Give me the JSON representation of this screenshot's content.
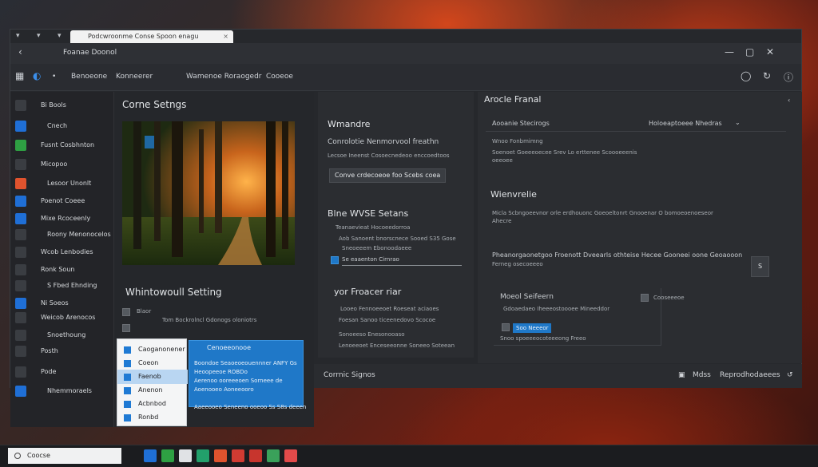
{
  "browser": {
    "tab_title": "Podcwroonme Conse Spoon enagu",
    "tab_close": "×",
    "back_glyph": "‹",
    "window_title": "Foanae Doonol"
  },
  "toolbar": {
    "items": [
      "Benoeone",
      "Konneerer",
      "Wamenoe Roraogedr",
      "Cooeoe"
    ]
  },
  "sidebar": {
    "items": [
      {
        "label": "Bi Bools",
        "color": "#3a3d42"
      },
      {
        "label": "Cnech",
        "color": "#1f6fd6"
      },
      {
        "label": "Fusnt Cosbhnton",
        "color": "#2ea043"
      },
      {
        "label": "Micopoo",
        "color": "#3a3d42"
      },
      {
        "label": "Lesoor Unonlt",
        "color": "#e0532e"
      },
      {
        "label": "Poenot Coeee",
        "color": "#1f6fd6"
      },
      {
        "label": "Mixe Rcoceenly",
        "color": "#1f6fd6"
      },
      {
        "label": "Roony Menonocelos",
        "color": "#3a3d42"
      },
      {
        "label": "Wcob Lenbodies",
        "color": "#3a3d42"
      },
      {
        "label": "Ronk Soun",
        "color": "#3a3d42"
      },
      {
        "label": "S Fbed Ehnding",
        "color": "#3a3d42"
      },
      {
        "label": "Ni Soeos",
        "color": "#1f6fd6"
      },
      {
        "label": "Weicob Arenocos",
        "color": "#3a3d42"
      },
      {
        "label": "Snoethoung",
        "color": "#3a3d42"
      },
      {
        "label": "Posth",
        "color": "#3a3d42"
      },
      {
        "label": "Pode",
        "color": "#3a3d42"
      },
      {
        "label": "Nhemmoraels",
        "color": "#1f6fd6"
      }
    ]
  },
  "col1": {
    "title": "Corne Setngs",
    "section": "Whintowoull Setting",
    "opt1": "Blaor",
    "opt2": "Tom Bockrolncl Gdonogs oloniotrs"
  },
  "col2": {
    "h1": "Wmandre",
    "h2": "Conrolotie Nenmorvool freathn",
    "desc": "Lecsoe Ineenst Cosoecnedeoo enccoedtoos",
    "btn": "Conve crdecoeoe foo Scebs coea",
    "h3": "Blne WVSE Setans",
    "l1": "Teanaevieat Hocoeedorroa",
    "l2": "Aob Sanoent bnorscnece Sooed S35 Gose",
    "l3": "Sneoeeem Ebonoodaeee",
    "field": "Se eaaenton Cirnrao",
    "h4": "yor Froacer riar",
    "l4": "Looeo Fennoeeoet Roeseat aciaoes",
    "l5": "Foesan Sanoo ticeenedovo Scocoe",
    "l6": "Sonoeeso Enesonooaso",
    "l7": "Lenoeeoet Enceseeonne Soneeo Soteean"
  },
  "col3": {
    "title": "Arocle Franal",
    "hdr_left": "Aooanie Stecirogs",
    "hdr_right": "Holoeaptoeee Nhedras",
    "r1": "Wnoo Fonbmimng",
    "r2": "Soenoet Goeeeoecee Srev Lo erttenee Scoooeeenis",
    "r3": "oeeoee",
    "h2": "Wienvrelie",
    "r4": "Micla Scbngoeevnor orle erdhouonc Goeoeltonrt Gnooenar O bomoeoenoeseor",
    "r5": "Ahecre",
    "h3": "Pheanorgaonetgoo Froenott Dveearls othteise Hecee Gooneei oone Geoaooon",
    "r6": "Ferneg osecoeeeo",
    "btn_s": "S",
    "h4": "Moeol Seifeern",
    "r7": "Gdoaedaeo Iheeeostoooee Mineeddor",
    "r8": "Cooseeeoe",
    "r9": "Soo Neeeor",
    "r10": "Snoo spoeeeocoteeeong Freeo"
  },
  "dropdown": {
    "items": [
      "Caoganonener",
      "Coeon",
      "Faenob",
      "Anenon",
      "Acbnbod",
      "Ronbd"
    ],
    "selected": 2,
    "pane_header": "Cenoeeonooe",
    "pane_rows": [
      "Boondoe Seaoeoeouennner ANFY Gs",
      "Heoopeeoe ROBDo",
      "Aerenoo ooreeeoen Sorneee de",
      "Aoenooeo Aoneeooro",
      "",
      "Aaeeooeo Seneeno ooeoo Ss S8s deeen"
    ]
  },
  "status": {
    "left": "Corrnic Signos",
    "mid": "Mdss",
    "right": "Reprodhodaeees"
  },
  "taskbar": {
    "search": "Coocse",
    "icons": [
      "#1f6fd6",
      "#2ea043",
      "#e0e2e5",
      "#22a06b",
      "#e0532e",
      "#d23b32",
      "#c7352d",
      "#3aa15a",
      "#e34a4a"
    ]
  },
  "colors": {
    "accent": "#1f78c8"
  }
}
